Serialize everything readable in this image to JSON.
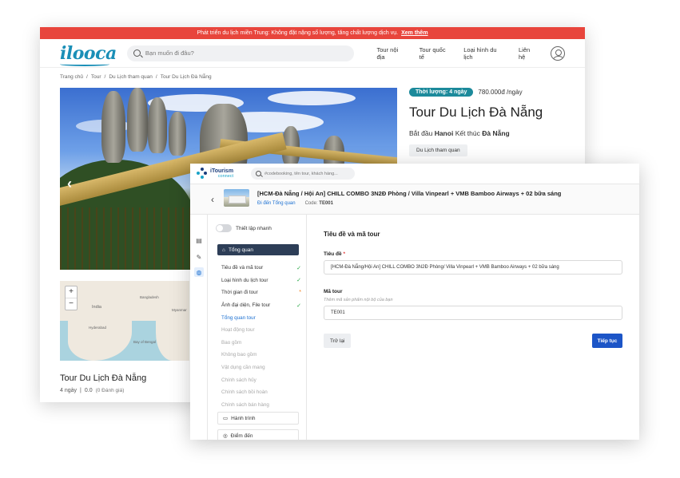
{
  "ilooca": {
    "promo": {
      "text": "Phát triển du lịch miền Trung: Không đặt nặng số lượng, tăng chất lượng dịch vụ.",
      "link": "Xem thêm"
    },
    "logo": "ilooca",
    "search": {
      "placeholder": "Bạn muốn đi đâu?"
    },
    "nav": [
      "Tour nội địa",
      "Tour quốc tế",
      "Loại hình du lịch",
      "Liên hệ"
    ],
    "breadcrumb": [
      "Trang chủ",
      "/",
      "Tour",
      "/",
      "Du Lịch tham quan",
      "/",
      "Tour Du Lịch Đà Nẵng"
    ],
    "duration_badge": "Thời lượng: 4 ngày",
    "price": "780.000đ /ngày",
    "title": "Tour Du Lịch Đà Nẵng",
    "route": {
      "start_label": "Bắt đầu",
      "start": "Hanoi",
      "end_label": "Kết thúc",
      "end": "Đà Nẵng"
    },
    "category": "Du Lịch tham quan",
    "map": {
      "zoom_in": "+",
      "zoom_out": "−",
      "labels": [
        "Bangladesh",
        "Myanmar",
        "India",
        "Bay of Bengal",
        "Hyderabad"
      ]
    },
    "footer": {
      "title": "Tour Du Lịch Đà Nẵng",
      "days": "4 ngày",
      "sep": "|",
      "rating": "0.0",
      "reviews": "(0 Đánh giá)"
    }
  },
  "itourism": {
    "logo": {
      "name": "iTourism",
      "sub": "connect"
    },
    "search": {
      "placeholder": "#codebooking, tên tour, khách hàng..."
    },
    "tour": {
      "title": "[HCM-Đà Nẵng / Hội An] CHILL COMBO 3N2Đ Phòng / Villa Vinpearl + VMB Bamboo Airways + 02 bữa sáng",
      "overview_link": "Đi đến Tổng quan",
      "code_label": "Code:",
      "code": "TE001"
    },
    "sidebar": {
      "quick_setup": "Thiết lập nhanh",
      "overview": "Tổng quan",
      "steps": [
        {
          "label": "Tiêu đề và mã tour",
          "status": "done",
          "mark": "✓"
        },
        {
          "label": "Loại hình du lịch tour",
          "status": "done",
          "mark": "✓"
        },
        {
          "label": "Thời gian đi tour",
          "status": "warn",
          "mark": "*"
        },
        {
          "label": "Ảnh đại diện, File tour",
          "status": "done",
          "mark": "✓"
        },
        {
          "label": "Tổng quan tour",
          "status": "current",
          "mark": ""
        },
        {
          "label": "Hoạt động tour",
          "status": "todo",
          "mark": ""
        },
        {
          "label": "Bao gồm",
          "status": "todo",
          "mark": ""
        },
        {
          "label": "Không bao gồm",
          "status": "todo",
          "mark": ""
        },
        {
          "label": "Vật dụng cần mang",
          "status": "todo",
          "mark": ""
        },
        {
          "label": "Chính sách hủy",
          "status": "todo",
          "mark": ""
        },
        {
          "label": "Chính sách bồi hoàn",
          "status": "todo",
          "mark": ""
        },
        {
          "label": "Chính sách bán hàng",
          "status": "todo",
          "mark": ""
        }
      ],
      "itinerary": "Hành trình",
      "destination": "Điểm đến"
    },
    "form": {
      "heading": "Tiêu đề và mã tour",
      "title_label": "Tiêu đề",
      "required_mark": "*",
      "title_value": "[HCM-Đà Nẵng/Hội An] CHILL COMBO 3N2Đ Phòng/ Villa Vinpearl + VMB Bamboo Airways + 02 bữa sáng",
      "code_label": "Mã tour",
      "code_hint": "Thêm mã sản phẩm nội bộ của bạn",
      "code_value": "TE001",
      "back_button": "Trở lại",
      "next_button": "Tiếp tục"
    }
  }
}
